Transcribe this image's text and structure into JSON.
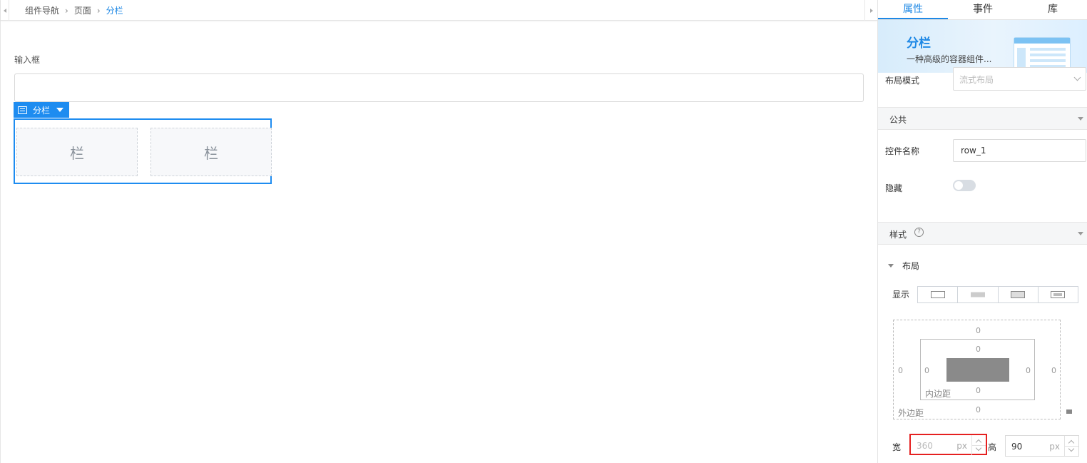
{
  "breadcrumb": {
    "items": [
      "组件导航",
      "页面"
    ],
    "current": "分栏"
  },
  "canvas": {
    "input_label": "输入框",
    "component_tag": "分栏",
    "columns": [
      "栏",
      "栏"
    ]
  },
  "panel": {
    "tabs": [
      "属性",
      "事件",
      "库"
    ],
    "active_tab": "属性",
    "banner": {
      "title": "分栏",
      "desc": "一种高级的容器组件..."
    },
    "layout_mode": {
      "label": "布局模式",
      "placeholder": "流式布局"
    },
    "section_public": "公共",
    "control_name": {
      "label": "控件名称",
      "value": "row_1"
    },
    "hidden": {
      "label": "隐藏",
      "on": false
    },
    "section_style": "样式",
    "help": "?",
    "layout_sub": "布局",
    "display_label": "显示",
    "box_model": {
      "margin": {
        "top": "0",
        "right": "0",
        "bottom": "0",
        "left": "0",
        "label": "外边距"
      },
      "padding": {
        "top": "0",
        "right": "0",
        "bottom": "0",
        "left": "0",
        "label": "内边距"
      }
    },
    "width": {
      "label": "宽",
      "value": "360",
      "unit": "px"
    },
    "height": {
      "label": "高",
      "value": "90",
      "unit": "px"
    }
  },
  "colors": {
    "accent": "#1e88e5",
    "highlight": "#e52020"
  }
}
